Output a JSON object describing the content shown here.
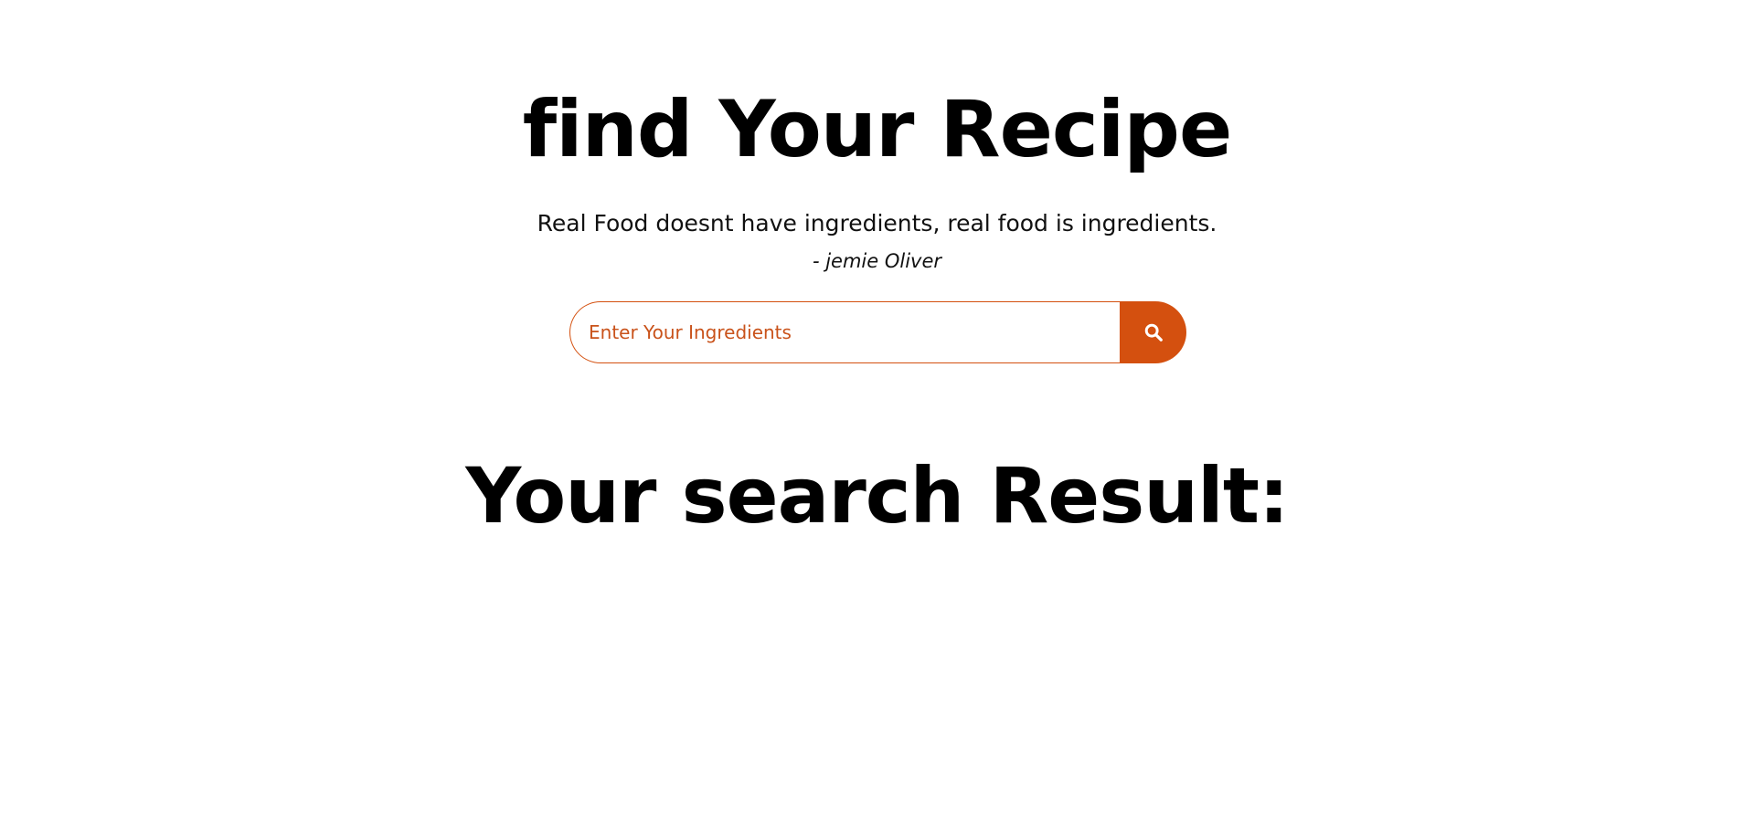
{
  "hero": {
    "title": "find Your Recipe",
    "quote": "Real Food doesnt have ingredients, real food is ingredients.",
    "author": "- jemie Oliver"
  },
  "search": {
    "placeholder": "Enter Your Ingredients",
    "value": "",
    "button_icon": "search-icon"
  },
  "results": {
    "title": "Your search Result:",
    "items": []
  },
  "colors": {
    "accent": "#d4500f",
    "text": "#000000",
    "background": "#ffffff"
  }
}
